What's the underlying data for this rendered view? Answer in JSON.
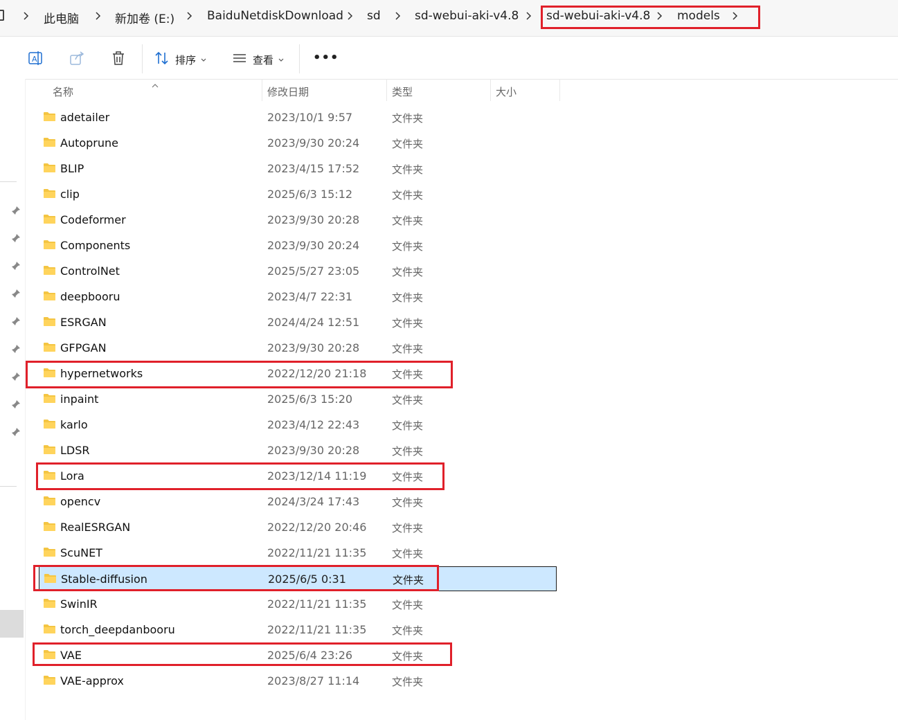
{
  "address_bar": {
    "crumbs": [
      "此电脑",
      "新加卷 (E:)",
      "BaiduNetdiskDownload",
      "sd",
      "sd-webui-aki-v4.8",
      "sd-webui-aki-v4.8",
      "models"
    ]
  },
  "toolbar": {
    "sort_label": "排序",
    "view_label": "查看",
    "more_label": "•••"
  },
  "columns": {
    "name": "名称",
    "date": "修改日期",
    "type": "类型",
    "size": "大小"
  },
  "files": [
    {
      "name": "adetailer",
      "date": "2023/10/1 9:57",
      "type": "文件夹"
    },
    {
      "name": "Autoprune",
      "date": "2023/9/30 20:24",
      "type": "文件夹"
    },
    {
      "name": "BLIP",
      "date": "2023/4/15 17:52",
      "type": "文件夹"
    },
    {
      "name": "clip",
      "date": "2025/6/3 15:12",
      "type": "文件夹"
    },
    {
      "name": "Codeformer",
      "date": "2023/9/30 20:28",
      "type": "文件夹"
    },
    {
      "name": "Components",
      "date": "2023/9/30 20:24",
      "type": "文件夹"
    },
    {
      "name": "ControlNet",
      "date": "2025/5/27 23:05",
      "type": "文件夹"
    },
    {
      "name": "deepbooru",
      "date": "2023/4/7 22:31",
      "type": "文件夹"
    },
    {
      "name": "ESRGAN",
      "date": "2024/4/24 12:51",
      "type": "文件夹"
    },
    {
      "name": "GFPGAN",
      "date": "2023/9/30 20:28",
      "type": "文件夹"
    },
    {
      "name": "hypernetworks",
      "date": "2022/12/20 21:18",
      "type": "文件夹"
    },
    {
      "name": "inpaint",
      "date": "2025/6/3 15:20",
      "type": "文件夹"
    },
    {
      "name": "karlo",
      "date": "2023/4/12 22:43",
      "type": "文件夹"
    },
    {
      "name": "LDSR",
      "date": "2023/9/30 20:28",
      "type": "文件夹"
    },
    {
      "name": "Lora",
      "date": "2023/12/14 11:19",
      "type": "文件夹"
    },
    {
      "name": "opencv",
      "date": "2024/3/24 17:43",
      "type": "文件夹"
    },
    {
      "name": "RealESRGAN",
      "date": "2022/12/20 20:46",
      "type": "文件夹"
    },
    {
      "name": "ScuNET",
      "date": "2022/11/21 11:35",
      "type": "文件夹"
    },
    {
      "name": "Stable-diffusion",
      "date": "2025/6/5 0:31",
      "type": "文件夹",
      "selected": true
    },
    {
      "name": "SwinIR",
      "date": "2022/11/21 11:35",
      "type": "文件夹"
    },
    {
      "name": "torch_deepdanbooru",
      "date": "2022/11/21 11:35",
      "type": "文件夹"
    },
    {
      "name": "VAE",
      "date": "2025/6/4 23:26",
      "type": "文件夹"
    },
    {
      "name": "VAE-approx",
      "date": "2023/8/27 11:14",
      "type": "文件夹"
    }
  ],
  "colors": {
    "highlight": "#e0202a",
    "selected_row": "#cde8ff",
    "folder": "#f4c542"
  }
}
